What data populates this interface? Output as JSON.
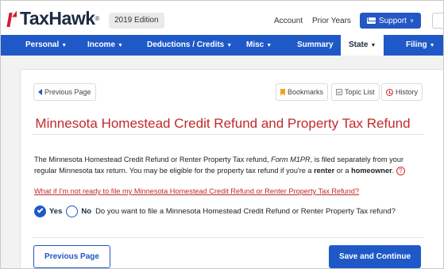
{
  "header": {
    "brand": "TaxHawk",
    "brand_tm": "®",
    "edition": "2019 Edition",
    "links": [
      "Account",
      "Prior Years"
    ],
    "support_label": "Support"
  },
  "nav": {
    "items": [
      {
        "label": "Personal"
      },
      {
        "label": "Income"
      },
      {
        "label": "Deductions / Credits"
      },
      {
        "label": "Misc"
      },
      {
        "label": "Summary"
      },
      {
        "label": "State"
      },
      {
        "label": "Filing"
      }
    ],
    "active": "State"
  },
  "toolbar": {
    "previous_page": "Previous Page",
    "bookmarks": "Bookmarks",
    "topic_list": "Topic List",
    "history": "History"
  },
  "page": {
    "title": "Minnesota Homestead Credit Refund and Property Tax Refund",
    "para_1": "The Minnesota Homestead Credit Refund or Renter Property Tax refund, ",
    "para_form": "Form M1PR",
    "para_2": ", is filed separately from your regular Minnesota tax return. You may be eligible for the property tax refund if you're a ",
    "para_renter": "renter",
    "para_3": " or a ",
    "para_homeowner": "homeowner",
    "para_4": ".",
    "help_glyph": "?",
    "link_text": "What if I'm not ready to file my Minnesota Homestead Credit Refund or Renter Property Tax Refund?",
    "yes_label": "Yes",
    "no_label": "No",
    "question": "Do you want to file a Minnesota Homestead Credit Refund or Renter Property Tax refund?",
    "selected": "Yes"
  },
  "footer": {
    "previous_button": "Previous Page",
    "continue_button": "Save and Continue"
  },
  "colors": {
    "brand_blue": "#1f59c8",
    "title_red": "#c22a2a",
    "logo_navy": "#1b2a41"
  }
}
